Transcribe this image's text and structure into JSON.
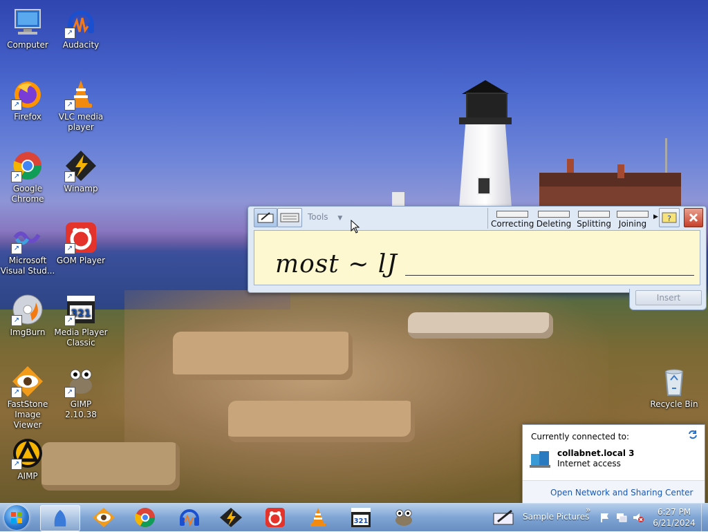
{
  "desktop": {
    "icons": [
      {
        "label": "Computer",
        "icon": "computer-icon"
      },
      {
        "label": "Audacity",
        "icon": "audacity-icon"
      },
      {
        "label": "Firefox",
        "icon": "firefox-icon"
      },
      {
        "label": "VLC media player",
        "icon": "vlc-icon"
      },
      {
        "label": "Google Chrome",
        "icon": "chrome-icon"
      },
      {
        "label": "Winamp",
        "icon": "winamp-icon"
      },
      {
        "label": "Microsoft Visual Stud...",
        "icon": "visual-studio-icon"
      },
      {
        "label": "GOM Player",
        "icon": "gom-player-icon"
      },
      {
        "label": "ImgBurn",
        "icon": "imgburn-icon"
      },
      {
        "label": "Media Player Classic",
        "icon": "media-player-classic-icon"
      },
      {
        "label": "FastStone Image Viewer",
        "icon": "faststone-icon"
      },
      {
        "label": "GIMP 2.10.38",
        "icon": "gimp-icon"
      },
      {
        "label": "AIMP",
        "icon": "aimp-icon"
      },
      {
        "label": "Recycle Bin",
        "icon": "recycle-bin-icon"
      }
    ]
  },
  "input_panel": {
    "tools_label": "Tools",
    "gestures": [
      "Correcting",
      "Deleting",
      "Splitting",
      "Joining"
    ],
    "ink_text": "most ~ lJ",
    "insert_label": "Insert"
  },
  "network_popup": {
    "header": "Currently connected to:",
    "network_name": "collabnet.local  3",
    "access": "Internet access",
    "link": "Open Network and Sharing Center"
  },
  "taskbar": {
    "toolbar_label": "Sample Pictures",
    "chevron": "»",
    "time": "6:27 PM",
    "date": "6/21/2024"
  }
}
